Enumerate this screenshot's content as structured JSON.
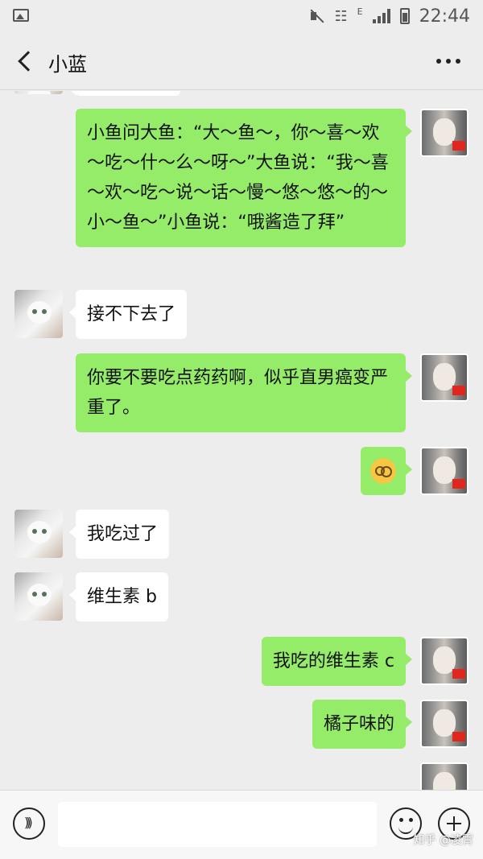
{
  "status_bar": {
    "time": "22:44",
    "network_type": "E",
    "icons": [
      "image-icon",
      "mute-icon",
      "wifi-icon",
      "signal-icon",
      "battery-icon"
    ]
  },
  "header": {
    "title": "小蓝",
    "back_icon": "chevron-left-icon",
    "more_icon": "more-dots-icon"
  },
  "messages": [
    {
      "side": "right",
      "type": "text",
      "text": "小鱼问大鱼：“大～鱼～，你～喜～欢～吃～什～么～呀～”大鱼说：“我～喜～欢～吃～说～话～慢～悠～悠～的～小～鱼～”小鱼说：“哦酱造了拜”"
    },
    {
      "side": "left",
      "type": "text",
      "text": "接不下去了"
    },
    {
      "side": "right",
      "type": "text",
      "text": "你要不要吃点药药啊，似乎直男癌变严重了。"
    },
    {
      "side": "right",
      "type": "emoji",
      "text": "",
      "emoji": "dizzy-face-emoji"
    },
    {
      "side": "left",
      "type": "text",
      "text": "我吃过了"
    },
    {
      "side": "left",
      "type": "text",
      "text": "维生素 b"
    },
    {
      "side": "right",
      "type": "text",
      "text": "我吃的维生素 c"
    },
    {
      "side": "right",
      "type": "text",
      "text": "橘子味的"
    }
  ],
  "colors": {
    "background": "#ededed",
    "bubble_self": "#95ec69",
    "bubble_other": "#ffffff"
  },
  "input_bar": {
    "placeholder": "",
    "voice_icon": "voice-icon",
    "emoji_icon": "smiley-icon",
    "plus_icon": "plus-icon"
  },
  "watermark": "知乎 @凌霄"
}
